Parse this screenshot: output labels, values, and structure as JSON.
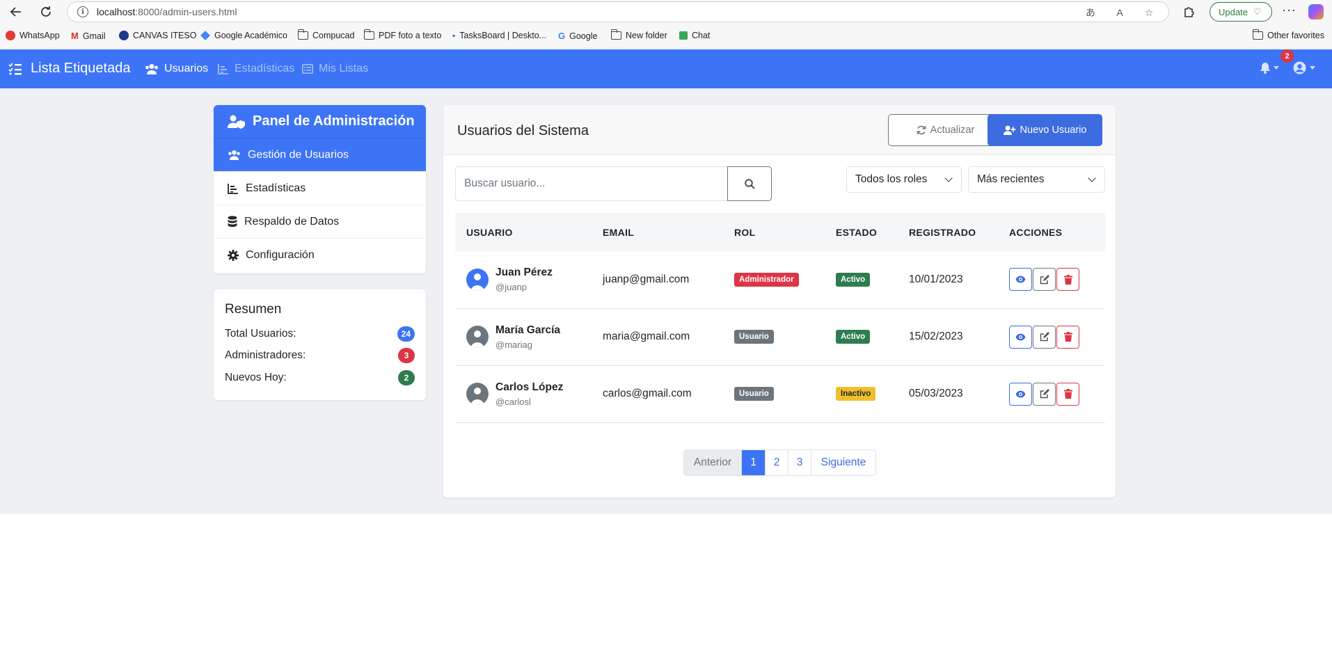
{
  "browser": {
    "url_host": "localhost",
    "url_path": ":8000/admin-users.html",
    "update_label": "Update",
    "bookmarks": [
      "WhatsApp",
      "Gmail",
      "CANVAS ITESO",
      "Google Académico",
      "Compucad",
      "PDF foto a texto",
      "TasksBoard | Deskto...",
      "Google",
      "New folder",
      "Chat"
    ],
    "other_favorites": "Other favorites"
  },
  "navbar": {
    "brand": "Lista Etiquetada",
    "links": [
      "Usuarios",
      "Estadísticas",
      "Mis Listas"
    ],
    "notification_count": "2"
  },
  "sidebar": {
    "title": "Panel de Administración",
    "items": [
      "Gestión de Usuarios",
      "Estadísticas",
      "Respaldo de Datos",
      "Configuración"
    ]
  },
  "summary": {
    "title": "Resumen",
    "rows": [
      {
        "label": "Total Usuarios:",
        "value": "24",
        "color": "#3d74f5"
      },
      {
        "label": "Administradores:",
        "value": "3",
        "color": "#dc3545"
      },
      {
        "label": "Nuevos Hoy:",
        "value": "2",
        "color": "#2e7d4f"
      }
    ]
  },
  "main": {
    "title": "Usuarios del Sistema",
    "refresh_label": "Actualizar",
    "new_user_label": "Nuevo Usuario",
    "search_placeholder": "Buscar usuario...",
    "role_filter": "Todos los roles",
    "sort_filter": "Más recientes",
    "columns": [
      "USUARIO",
      "EMAIL",
      "ROL",
      "ESTADO",
      "REGISTRADO",
      "ACCIONES"
    ],
    "users": [
      {
        "name": "Juan Pérez",
        "handle": "@juanp",
        "email": "juanp@gmail.com",
        "role": "Administrador",
        "role_color": "#dc3545",
        "status": "Activo",
        "status_color": "#2e7d4f",
        "registered": "10/01/2023",
        "avatar_color": "#3d74f5"
      },
      {
        "name": "María García",
        "handle": "@mariag",
        "email": "maria@gmail.com",
        "role": "Usuario",
        "role_color": "#6c757d",
        "status": "Activo",
        "status_color": "#2e7d4f",
        "registered": "15/02/2023",
        "avatar_color": "#6c757d"
      },
      {
        "name": "Carlos López",
        "handle": "@carlosl",
        "email": "carlos@gmail.com",
        "role": "Usuario",
        "role_color": "#6c757d",
        "status": "Inactivo",
        "status_color": "#f0c02a",
        "registered": "05/03/2023",
        "avatar_color": "#6c757d"
      }
    ],
    "pagination": {
      "prev": "Anterior",
      "pages": [
        "1",
        "2",
        "3"
      ],
      "next": "Siguiente",
      "current": "1"
    }
  }
}
